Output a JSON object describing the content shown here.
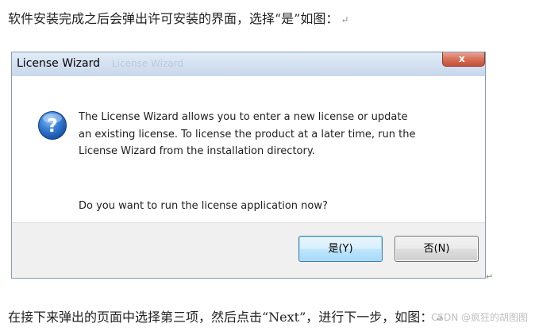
{
  "document": {
    "line1": "软件安装完成之后会弹出许可安装的界面，选择“是”如图：",
    "line2": "在接下来弹出的页面中选择第三项，然后点击“Next”，进行下一步，如图：",
    "paragraph_mark": "↵",
    "watermark": "CSDN @疯狂的胡图图"
  },
  "dialog": {
    "title": "License Wizard",
    "title_ghost": "License Wizard",
    "close_glyph": "x",
    "icon": "question-icon",
    "message_lines": [
      "The License Wizard allows you to enter a new license or update",
      "an existing license. To license the product at a later time, run the",
      "License Wizard from the installation directory."
    ],
    "question": "Do you want to run the license application now?",
    "buttons": {
      "yes": "是(Y)",
      "no": "否(N)"
    }
  },
  "colors": {
    "titlebar": "#d4e1f1",
    "close_button": "#c44f36",
    "footer": "#f0f0f0",
    "icon_blue": "#1f5fb8"
  }
}
